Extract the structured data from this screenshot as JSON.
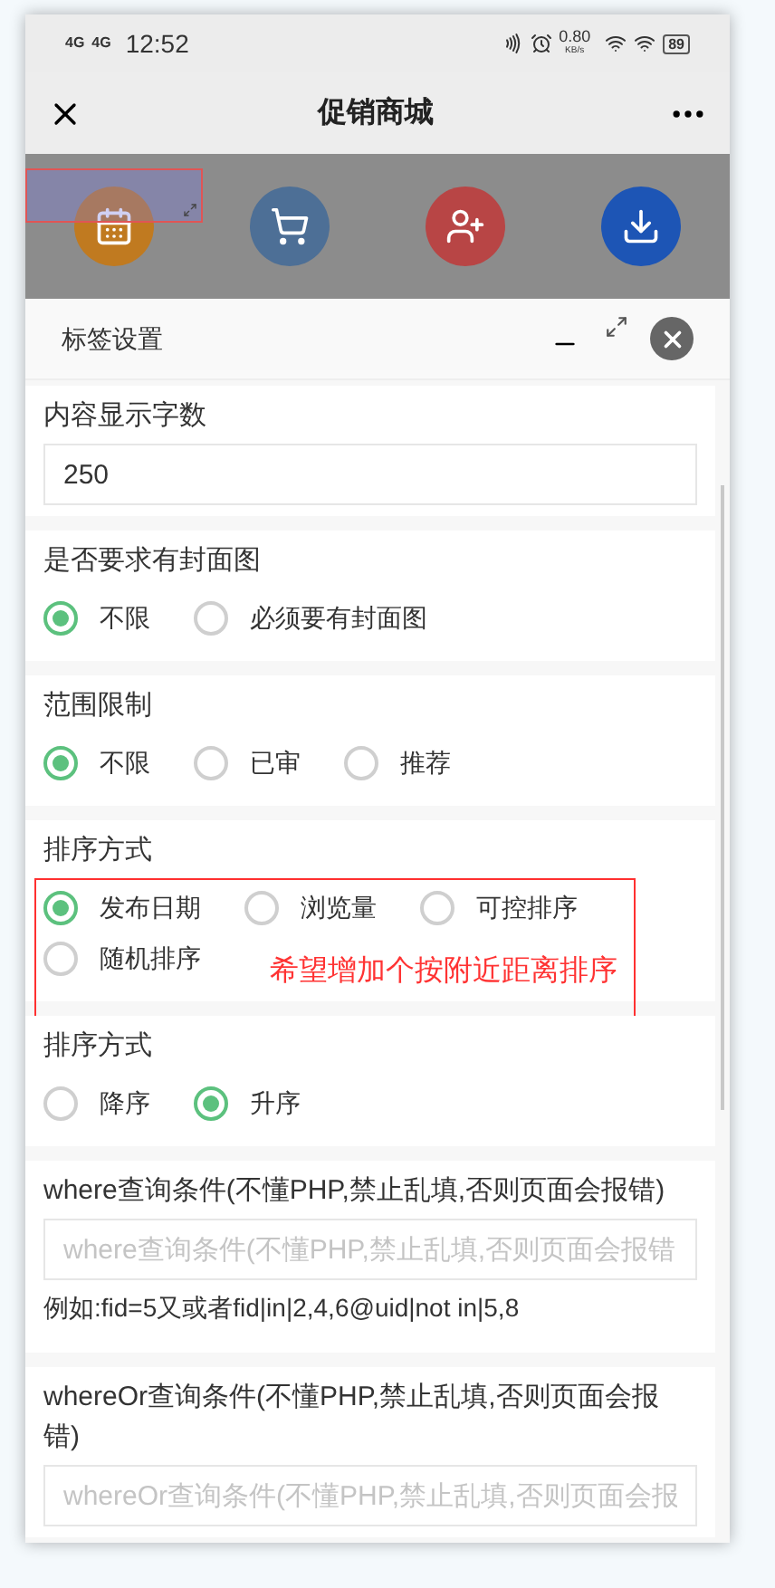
{
  "status_bar": {
    "signals": [
      "4G",
      "4G"
    ],
    "time": "12:52",
    "speed": "0.80",
    "speed_unit": "KB/s",
    "battery": "89"
  },
  "nav": {
    "title": "促销商城"
  },
  "background_page": {
    "shortcuts": [
      {
        "kind": "calendar",
        "color": "#c07a20"
      },
      {
        "kind": "cart",
        "color": "#4d6f96"
      },
      {
        "kind": "user-add",
        "color": "#b84545"
      },
      {
        "kind": "download",
        "color": "#1d55b5"
      }
    ]
  },
  "dialog": {
    "title": "标签设置",
    "sections": [
      {
        "kind": "input",
        "label": "内容显示字数",
        "value": "250"
      },
      {
        "kind": "radio",
        "label": "是否要求有封面图",
        "options": [
          {
            "label": "不限",
            "selected": true
          },
          {
            "label": "必须要有封面图",
            "selected": false
          }
        ]
      },
      {
        "kind": "radio",
        "label": "范围限制",
        "options": [
          {
            "label": "不限",
            "selected": true
          },
          {
            "label": "已审",
            "selected": false
          },
          {
            "label": "推荐",
            "selected": false
          }
        ]
      },
      {
        "kind": "radio",
        "label": "排序方式",
        "annotation": "希望增加个按附近距离排序",
        "options": [
          {
            "label": "发布日期",
            "selected": true
          },
          {
            "label": "浏览量",
            "selected": false
          },
          {
            "label": "可控排序",
            "selected": false
          },
          {
            "label": "随机排序",
            "selected": false
          }
        ]
      },
      {
        "kind": "radio",
        "label": "排序方式",
        "options": [
          {
            "label": "降序",
            "selected": false
          },
          {
            "label": "升序",
            "selected": true
          }
        ]
      },
      {
        "kind": "input",
        "label": "where查询条件(不懂PHP,禁止乱填,否则页面会报错)",
        "placeholder": "where查询条件(不懂PHP,禁止乱填,否则页面会报错",
        "hint": "例如:fid=5又或者fid|in|2,4,6@uid|not in|5,8"
      },
      {
        "kind": "input",
        "label": "whereOr查询条件(不懂PHP,禁止乱填,否则页面会报错)",
        "placeholder": "whereOr查询条件(不懂PHP,禁止乱填,否则页面会报"
      }
    ]
  }
}
